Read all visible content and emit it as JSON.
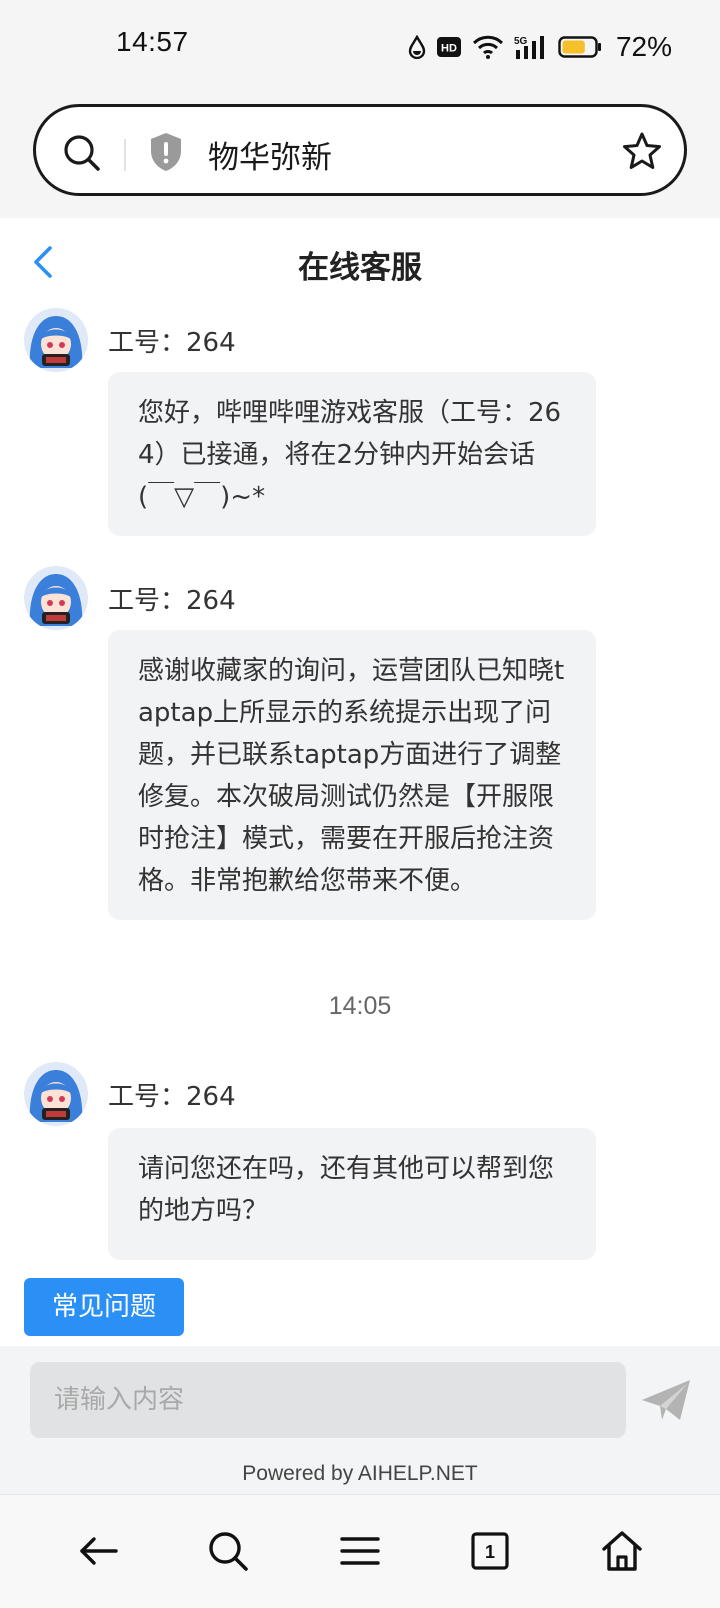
{
  "status_bar": {
    "time": "14:57",
    "icons": [
      "water-drop-icon",
      "hd-icon",
      "wifi-icon",
      "5g-signal-icon",
      "battery-icon"
    ],
    "hd_label": "HD",
    "network_label": "5G",
    "battery_level": 0.72,
    "battery_text": "72%"
  },
  "address_bar": {
    "title": "物华弥新",
    "icons": [
      "search-icon",
      "shield-icon",
      "star-icon"
    ]
  },
  "header": {
    "title": "在线客服",
    "back_icon": "chevron-left-icon"
  },
  "chat": {
    "messages": [
      {
        "agent": "工号：264",
        "text": "您好，哔哩哔哩游戏客服（工号：264）已接通，将在2分钟内开始会话(￣▽￣)~*"
      },
      {
        "agent": "工号：264",
        "text": "感谢收藏家的询问，运营团队已知晓taptap上所显示的系统提示出现了问题，并已联系taptap方面进行了调整修复。本次破局测试仍然是【开服限时抢注】模式，需要在开服后抢注资格。非常抱歉给您带来不便。"
      },
      {
        "agent": "工号：264",
        "text": "请问您还在吗，还有其他可以帮到您的地方吗？"
      }
    ],
    "time_separator": "14:05"
  },
  "faq": {
    "label": "常见问题"
  },
  "input": {
    "placeholder": "请输入内容",
    "value": "",
    "send_icon": "send-icon"
  },
  "powered_by": "Powered by AIHELP.NET",
  "bottom_nav": {
    "items": [
      "back-arrow-icon",
      "search-icon",
      "menu-icon",
      "tabs-icon",
      "home-icon"
    ],
    "tab_count": "1"
  },
  "colors": {
    "accent": "#2a90f5",
    "bubble_bg": "#f2f3f5",
    "input_bg": "#e1e2e4",
    "battery_fill": "#f5c02a"
  }
}
